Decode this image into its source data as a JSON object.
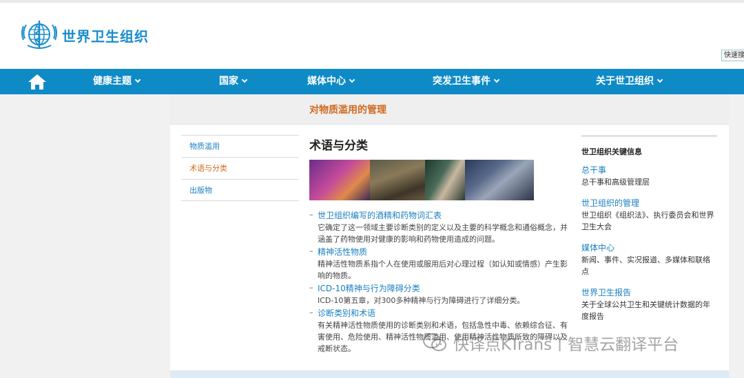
{
  "header": {
    "logo_text": "世界卫生组织",
    "quick_link": "快速搜"
  },
  "nav": {
    "home_icon": "house-icon",
    "items": [
      {
        "label": "健康主题"
      },
      {
        "label": "国家"
      },
      {
        "label": "媒体中心"
      },
      {
        "label": "突发卫生事件"
      },
      {
        "label": "关于世卫组织"
      }
    ]
  },
  "page": {
    "title": "对物质滥用的管理"
  },
  "left_nav": {
    "items": [
      {
        "label": "物质滥用"
      },
      {
        "label": "术语与分类"
      },
      {
        "label": "出版物"
      }
    ],
    "active_index": 1
  },
  "main": {
    "heading": "术语与分类",
    "entries": [
      {
        "link": "世卫组织编写的酒精和药物词汇表",
        "desc": "它确定了这一领域主要诊断类别的定义以及主要的科学概念和通俗概念，并涵盖了药物使用对健康的影响和药物使用造成的问题。"
      },
      {
        "link": "精神活性物质",
        "desc": "精神活性物质系指个人在使用或服用后对心理过程（如认知或情感）产生影响的物质。"
      },
      {
        "link": "ICD-10精神与行为障碍分类",
        "desc": "ICD-10第五章，对300多种精神与行为障碍进行了详细分类。"
      },
      {
        "link": "诊断类别和术语",
        "desc": "有关精神活性物质使用的诊断类别和术语，包括急性中毒、依赖综合征、有害使用、危险使用、精神活性物质滥用、使用精神活性物质所致的障碍以及戒断状态。"
      }
    ]
  },
  "sidebar": {
    "title": "世卫组织关键信息",
    "items": [
      {
        "link": "总干事",
        "desc": "总干事和高级管理层"
      },
      {
        "link": "世卫组织的管理",
        "desc": "世卫组织《组织法》、执行委员会和世界卫生大会"
      },
      {
        "link": "媒体中心",
        "desc": "新闻、事件、实况报道、多媒体和联络点"
      },
      {
        "link": "世界卫生报告",
        "desc": "关于全球公共卫生和关键统计数据的年度报告"
      }
    ]
  },
  "watermark": {
    "text": "快译点KTrans丨智慧云翻译平台"
  },
  "colors": {
    "nav_bg": "#0e8bc6",
    "link": "#1a7fc1",
    "title": "#d2691e"
  }
}
